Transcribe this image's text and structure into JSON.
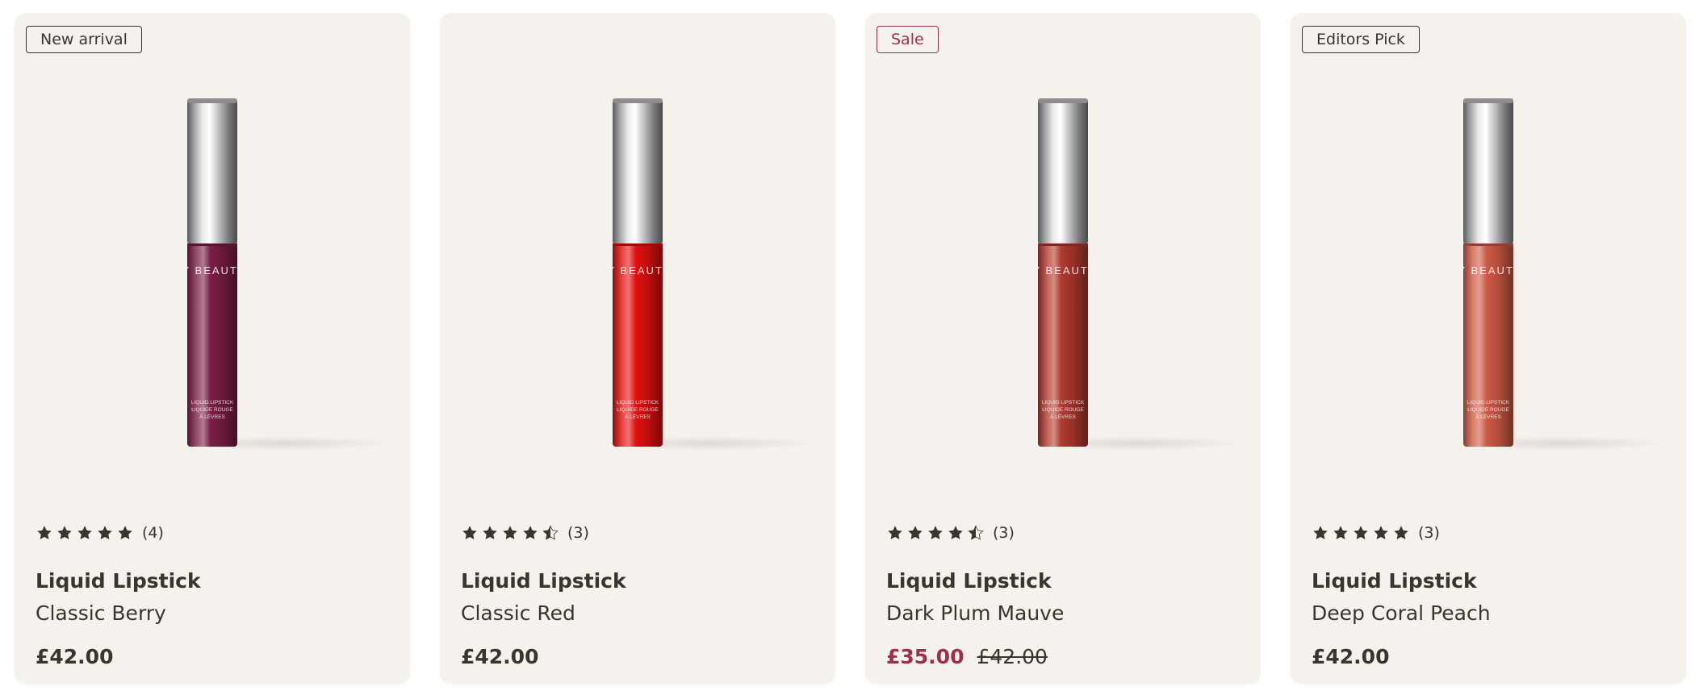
{
  "products": [
    {
      "badge": "New arrival",
      "badge_type": "default",
      "rating": 5,
      "review_count": "(4)",
      "name": "Liquid Lipstick",
      "shade": "Classic Berry",
      "price": "£42.00",
      "was_price": "",
      "price_type": "regular",
      "tube_color": "#7a1f45",
      "brand_text": "FY BEAUTIF",
      "label_lines": [
        "LIQUID LIPSTICK",
        "LIQUIDE ROUGE",
        "À LÈVRES"
      ]
    },
    {
      "badge": "",
      "badge_type": "default",
      "rating": 4.5,
      "review_count": "(3)",
      "name": "Liquid Lipstick",
      "shade": "Classic Red",
      "price": "£42.00",
      "was_price": "",
      "price_type": "regular",
      "tube_color": "#e0100f",
      "brand_text": "FY BEAUTIF",
      "label_lines": [
        "LIQUID LIPSTICK",
        "LIQUIDE ROUGE",
        "À LÈVRES"
      ]
    },
    {
      "badge": "Sale",
      "badge_type": "sale",
      "rating": 4.5,
      "review_count": "(3)",
      "name": "Liquid Lipstick",
      "shade": "Dark Plum Mauve",
      "price": "£35.00",
      "was_price": "£42.00",
      "price_type": "sale",
      "tube_color": "#b13a30",
      "brand_text": "FY BEAUTIF",
      "label_lines": [
        "LIQUID LIPSTICK",
        "LIQUIDE ROUGE",
        "À LÈVRES"
      ]
    },
    {
      "badge": "Editors Pick",
      "badge_type": "default",
      "rating": 5,
      "review_count": "(3)",
      "name": "Liquid Lipstick",
      "shade": "Deep Coral Peach",
      "price": "£42.00",
      "was_price": "",
      "price_type": "regular",
      "tube_color": "#cf5a45",
      "brand_text": "FY BEAUTIF",
      "label_lines": [
        "LIQUID LIPSTICK",
        "LIQUIDE ROUGE",
        "À LÈVRES"
      ]
    }
  ],
  "colors": {
    "card_bg": "#f5f2ee",
    "text": "#3b332d",
    "sale": "#9e2d4f",
    "star": "#3b332d"
  }
}
